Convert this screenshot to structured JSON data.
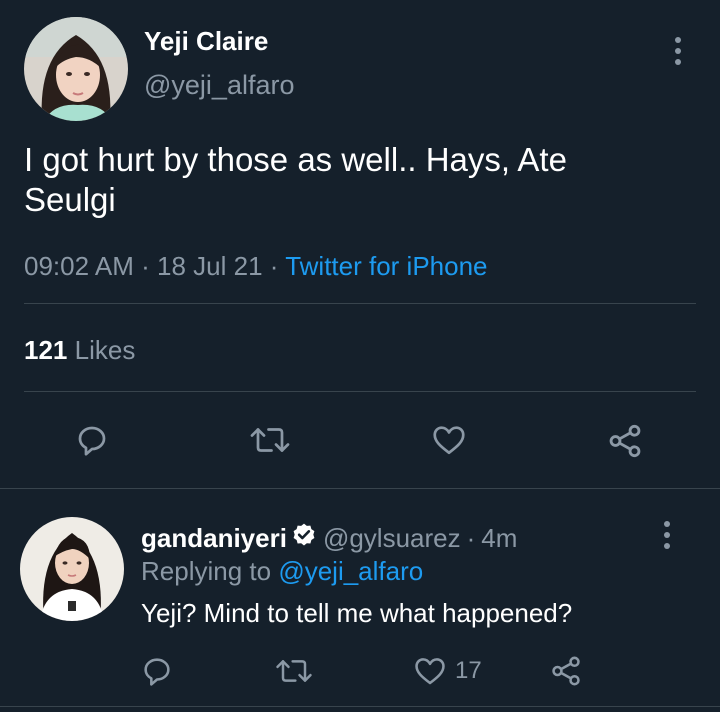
{
  "tweet": {
    "avatar_icon": "profile-photo",
    "name": "Yeji Claire",
    "handle": "@yeji_alfaro",
    "text": "I got hurt by those as well.. Hays, Ate Seulgi",
    "time": "09:02 AM",
    "date": "18 Jul 21",
    "separator": "·",
    "source": "Twitter for iPhone",
    "likes_count": "121",
    "likes_label": "Likes",
    "actions": [
      "reply-icon",
      "retweet-icon",
      "like-icon",
      "share-icon"
    ]
  },
  "reply": {
    "avatar_icon": "profile-photo",
    "name": "gandaniyeri",
    "verified_icon": "verified-badge-icon",
    "handle": "@gylsuarez",
    "separator": "·",
    "time": "4m",
    "replying_label": "Replying to",
    "replying_to": "@yeji_alfaro",
    "text": "Yeji? Mind to tell me what happened?",
    "like_count": "17",
    "actions": [
      "reply-icon",
      "retweet-icon",
      "like-icon",
      "share-icon"
    ]
  },
  "colors": {
    "background": "#15202b",
    "text": "#ffffff",
    "secondary": "#8b98a5",
    "link": "#1d9bf0",
    "divider": "#38444d"
  }
}
